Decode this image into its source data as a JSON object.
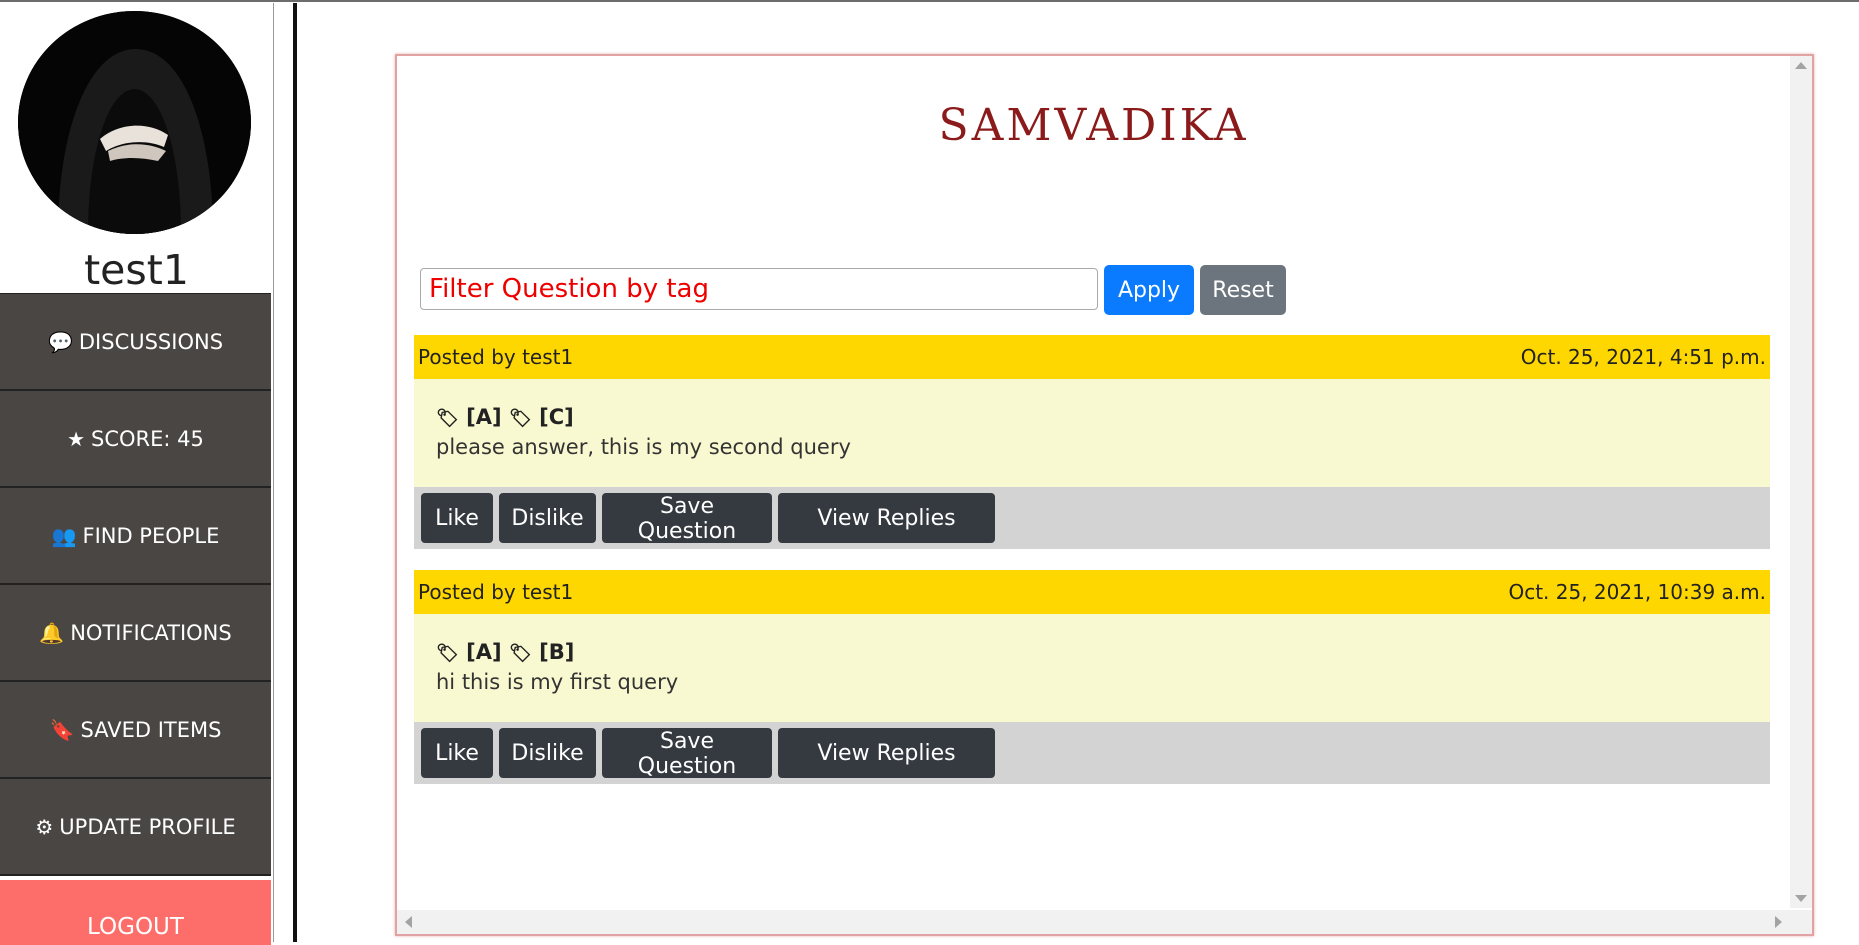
{
  "sidebar": {
    "username": "test1",
    "items": [
      {
        "icon": "comment-icon",
        "glyph": "💬",
        "label": "DISCUSSIONS"
      },
      {
        "icon": "star-icon",
        "glyph": "★",
        "label": "SCORE: 45"
      },
      {
        "icon": "users-icon",
        "glyph": "👥",
        "label": "FIND PEOPLE"
      },
      {
        "icon": "bell-icon",
        "glyph": "🔔",
        "label": "NOTIFICATIONS"
      },
      {
        "icon": "bookmark-icon",
        "glyph": "🔖",
        "label": "SAVED ITEMS"
      },
      {
        "icon": "gear-icon",
        "glyph": "⚙",
        "label": "UPDATE PROFILE"
      }
    ],
    "logout_label": "LOGOUT"
  },
  "main": {
    "title": "SAMVADIKA",
    "filter": {
      "placeholder": "Filter Question by tag",
      "value": ""
    },
    "apply_label": "Apply",
    "reset_label": "Reset",
    "questions": [
      {
        "posted_by": "Posted by test1",
        "timestamp": "Oct. 25, 2021, 4:51 p.m.",
        "tags": [
          "[A]",
          "[C]"
        ],
        "text": "please answer, this is my second query",
        "actions": {
          "like": "Like",
          "dislike": "Dislike",
          "save": "Save Question",
          "view": "View Replies"
        }
      },
      {
        "posted_by": "Posted by test1",
        "timestamp": "Oct. 25, 2021, 10:39 a.m.",
        "tags": [
          "[A]",
          "[B]"
        ],
        "text": "hi this is my first query",
        "actions": {
          "like": "Like",
          "dislike": "Dislike",
          "save": "Save Question",
          "view": "View Replies"
        }
      }
    ]
  },
  "colors": {
    "sidebar_item": "#4a4644",
    "logout": "#fd6e6b",
    "title": "#8b1a1a",
    "question_header": "#ffd700",
    "question_body": "#f9f9d1",
    "action_bar": "#d3d3d3",
    "action_button": "#343a40",
    "apply": "#0a7bff",
    "reset": "#6c757d"
  }
}
